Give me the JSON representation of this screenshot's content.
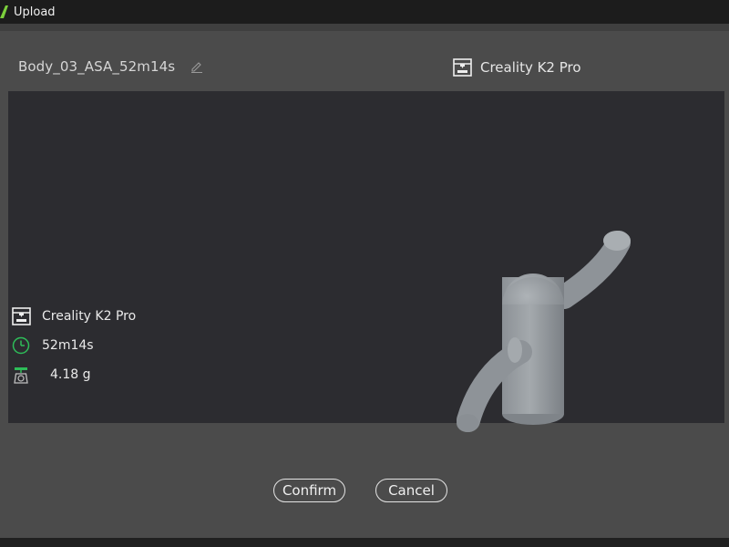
{
  "window": {
    "title": "Upload"
  },
  "header": {
    "filename": "Body_03_ASA_52m14s",
    "printer": "Creality K2 Pro"
  },
  "info": {
    "printer": "Creality K2 Pro",
    "time": "52m14s",
    "weight": "4.18 g"
  },
  "buttons": {
    "confirm": "Confirm",
    "cancel": "Cancel"
  },
  "icons": [
    "app-logo-icon",
    "edit-pencil-icon",
    "printer-icon",
    "clock-icon",
    "scale-icon"
  ],
  "colors": {
    "preview_bg": "#2c2c30",
    "dialog_bg": "#4b4b4b",
    "accent_green": "#2ebd59"
  }
}
